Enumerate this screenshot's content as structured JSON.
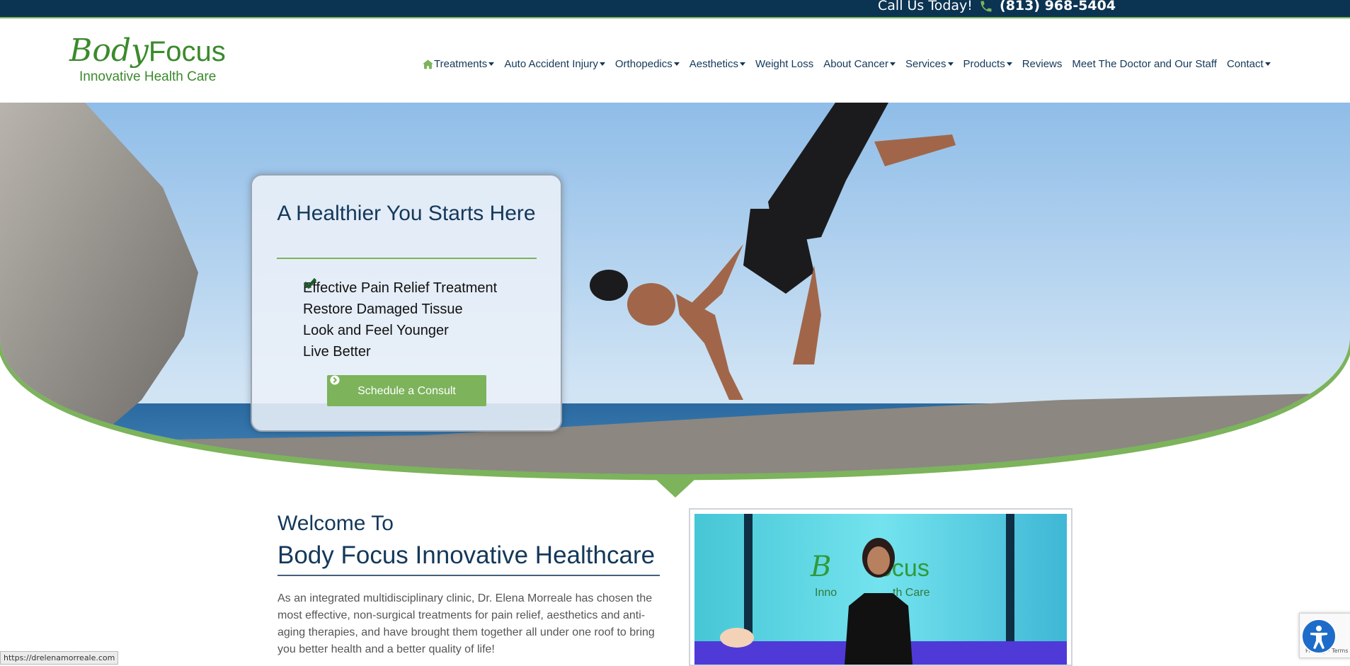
{
  "topbar": {
    "call_label": "Call Us Today!",
    "phone": "(813) 968-5404"
  },
  "brand": {
    "logo_script": "Body",
    "logo_focus": "Focus",
    "tagline": "Innovative Health Care"
  },
  "nav": {
    "items": [
      {
        "label": "Treatments",
        "dropdown": true
      },
      {
        "label": "Auto Accident Injury",
        "dropdown": true
      },
      {
        "label": "Orthopedics",
        "dropdown": true
      },
      {
        "label": "Aesthetics",
        "dropdown": true
      },
      {
        "label": "Weight Loss",
        "dropdown": false
      },
      {
        "label": "About Cancer",
        "dropdown": true
      },
      {
        "label": "Services",
        "dropdown": true
      },
      {
        "label": "Products",
        "dropdown": true
      },
      {
        "label": "Reviews",
        "dropdown": false
      },
      {
        "label": "Meet The Doctor and Our Staff",
        "dropdown": false
      },
      {
        "label": "Contact",
        "dropdown": true
      }
    ]
  },
  "hero": {
    "title": "A Healthier You Starts Here",
    "benefits": [
      "Effective Pain Relief Treatment",
      "Restore Damaged Tissue",
      "Look and Feel Younger",
      "Live Better"
    ],
    "cta": "Schedule a Consult"
  },
  "welcome": {
    "line1": "Welcome To",
    "line2": "Body Focus Innovative Healthcare",
    "body": "As an integrated multidisciplinary clinic, Dr. Elena Morreale has chosen the most effective, non-surgical treatments for pain relief, aesthetics and anti-aging therapies, and have brought them together all under one roof to bring you better health and a better quality of life!"
  },
  "video": {
    "brand_text": "Body Focus",
    "brand_sub": "Innovative Health Care"
  },
  "status_url": "https://drelenamorreale.com",
  "recaptcha_text": "Privacy - Terms",
  "colors": {
    "navy": "#0b3352",
    "green": "#7cb35b",
    "brand_green": "#3b8a2d",
    "text": "#14385a"
  }
}
